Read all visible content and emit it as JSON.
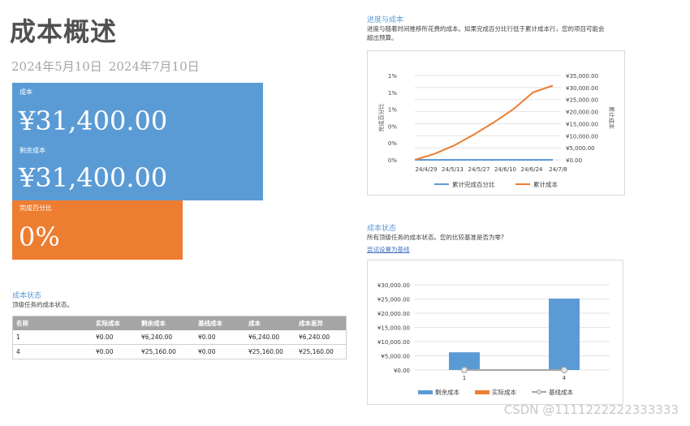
{
  "page": {
    "title": "成本概述",
    "start_date": "2024年5月10日",
    "end_date": "2024年7月10日"
  },
  "tiles": {
    "cost_label": "成本",
    "cost_value": "¥31,400.00",
    "remaining_label": "剩余成本",
    "remaining_value": "¥31,400.00",
    "percent_label": "完成百分比",
    "percent_value": "0%"
  },
  "colors": {
    "blue": "#5b9bd5",
    "orange": "#ed7d31",
    "gray": "#a5a5a5"
  },
  "progress": {
    "title": "进度与成本",
    "desc_line1": "进度与随着时间推移所花费的成本。如果完成百分比行低于累计成本行，您的项目可能会",
    "desc_line2": "超出预算。"
  },
  "status_right": {
    "title": "成本状态",
    "desc": "所有顶级任务的成本状态。您的比较基准是否为零?",
    "link": "尝试设置为基线"
  },
  "status_left": {
    "title": "成本状态",
    "desc": "顶级任务的成本状态。",
    "columns": [
      "名称",
      "实际成本",
      "剩余成本",
      "基线成本",
      "成本",
      "成本差异"
    ],
    "rows": [
      [
        "1",
        "¥0.00",
        "¥6,240.00",
        "¥0.00",
        "¥6,240.00",
        "¥6,240.00"
      ],
      [
        "4",
        "¥0.00",
        "¥25,160.00",
        "¥0.00",
        "¥25,160.00",
        "¥25,160.00"
      ]
    ]
  },
  "watermark": "CSDN @1111222222333333",
  "chart_data": [
    {
      "type": "line",
      "title": "",
      "x": [
        "24/4/29",
        "24/5/13",
        "24/5/27",
        "24/6/10",
        "24/6/24",
        "24/7/8"
      ],
      "ylabel": "完成百分比",
      "y2label": "累计成本",
      "y_ticks": [
        "0%",
        "0%",
        "0%",
        "1%",
        "1%",
        "1%"
      ],
      "y2_ticks": [
        "¥0.00",
        "¥5,000.00",
        "¥10,000.00",
        "¥15,000.00",
        "¥20,000.00",
        "¥25,000.00",
        "¥30,000.00",
        "¥35,000.00"
      ],
      "y2lim": [
        0,
        35000
      ],
      "series": [
        {
          "name": "累计完成百分比",
          "axis": "left",
          "color": "#5b9bd5",
          "values": [
            0,
            0,
            0,
            0,
            0,
            0,
            0,
            0,
            0,
            0
          ]
        },
        {
          "name": "累计成本",
          "axis": "right",
          "color": "#ed7d31",
          "values": [
            0,
            2500,
            6000,
            10500,
            15500,
            21000,
            28000,
            30800
          ]
        }
      ],
      "legend": "bottom",
      "grid": true
    },
    {
      "type": "bar",
      "categories": [
        "1",
        "4"
      ],
      "y_ticks": [
        "¥0.00",
        "¥5,000.00",
        "¥10,000.00",
        "¥15,000.00",
        "¥20,000.00",
        "¥25,000.00",
        "¥30,000.00"
      ],
      "ylim": [
        0,
        30000
      ],
      "series": [
        {
          "name": "剩余成本",
          "color": "#5b9bd5",
          "values": [
            6240,
            25160
          ]
        },
        {
          "name": "实际成本",
          "color": "#ed7d31",
          "values": [
            0,
            0
          ]
        },
        {
          "name": "基线成本",
          "color": "#a5a5a5",
          "values": [
            0,
            0
          ],
          "kind": "line"
        }
      ],
      "legend": "bottom",
      "grid": true
    }
  ]
}
